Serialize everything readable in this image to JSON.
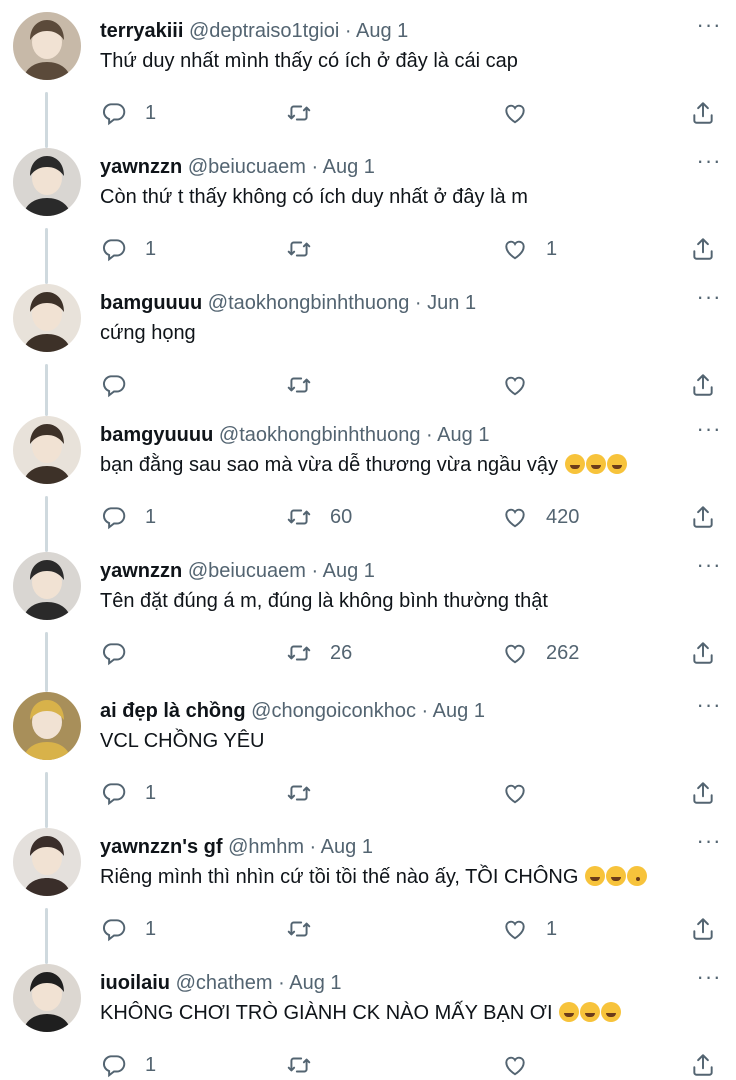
{
  "tweets": [
    {
      "name": "terryakiii",
      "handle": "@deptraiso1tgioi",
      "date": "Aug 1",
      "text": "Thứ duy nhất mình thấy có ích ở đây là cái cap",
      "emojis": [],
      "replies": "1",
      "retweets": "",
      "likes": ""
    },
    {
      "name": "yawnzzn",
      "handle": "@beiucuaem",
      "date": "Aug 1",
      "text": "Còn thứ t thấy không có ích duy nhất ở đây là m",
      "emojis": [],
      "replies": "1",
      "retweets": "",
      "likes": "1"
    },
    {
      "name": "bamguuuu",
      "handle": "@taokhongbinhthuong",
      "date": "Jun 1",
      "text": "cứng họng",
      "emojis": [],
      "replies": "",
      "retweets": "",
      "likes": ""
    },
    {
      "name": "bamgyuuuu",
      "handle": "@taokhongbinhthuong",
      "date": "Aug 1",
      "text": "bạn đằng sau sao mà vừa dễ thương vừa ngầu vậy",
      "emojis": [
        "sob",
        "sob",
        "sob"
      ],
      "replies": "1",
      "retweets": "60",
      "likes": "420"
    },
    {
      "name": "yawnzzn",
      "handle": "@beiucuaem",
      "date": "Aug 1",
      "text": "Tên đặt đúng á m, đúng là không bình thường thật",
      "emojis": [],
      "replies": "",
      "retweets": "26",
      "likes": "262"
    },
    {
      "name": "ai đẹp là chồng",
      "handle": "@chongoiconkhoc",
      "date": "Aug 1",
      "text": "VCL CHỒNG YÊU",
      "emojis": [],
      "replies": "1",
      "retweets": "",
      "likes": ""
    },
    {
      "name": "yawnzzn's gf",
      "handle": "@hmhm",
      "date": "Aug 1",
      "text": "Riêng mình thì nhìn cứ tồi tồi thế nào ấy, TỒI CHÔNG",
      "emojis": [
        "sob",
        "sob",
        "kiss"
      ],
      "replies": "1",
      "retweets": "",
      "likes": "1"
    },
    {
      "name": "iuoilaiu",
      "handle": "@chathem",
      "date": "Aug 1",
      "text": "KHÔNG CHƠI TRÒ GIÀNH CK NÀO MẤY BẠN ƠI",
      "emojis": [
        "sob",
        "sob",
        "sob"
      ],
      "replies": "1",
      "retweets": "",
      "likes": ""
    }
  ],
  "ui": {
    "separator": "·",
    "more": "···"
  },
  "icons": {
    "reply": "reply-icon",
    "retweet": "retweet-icon",
    "like": "heart-icon",
    "share": "share-icon",
    "more": "more-icon"
  },
  "colors": {
    "text": "#0f1419",
    "secondary": "#536471",
    "thread_line": "#cfd9de"
  }
}
